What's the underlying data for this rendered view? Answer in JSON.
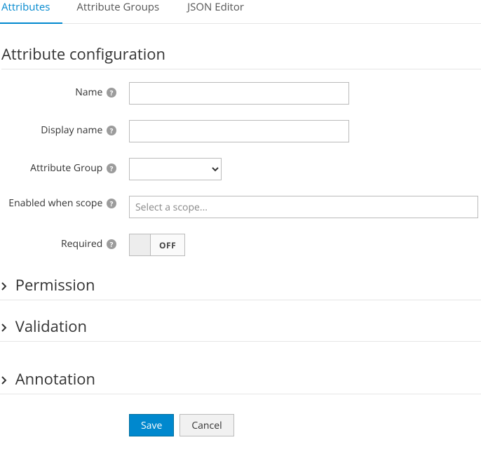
{
  "tabs": {
    "attributes": "Attributes",
    "groups": "Attribute Groups",
    "json": "JSON Editor"
  },
  "section_title": "Attribute configuration",
  "form": {
    "name_label": "Name",
    "name_value": "",
    "display_name_label": "Display name",
    "display_name_value": "",
    "attribute_group_label": "Attribute Group",
    "attribute_group_value": "",
    "enabled_when_scope_label": "Enabled when scope",
    "enabled_when_scope_placeholder": "Select a scope...",
    "enabled_when_scope_value": "",
    "required_label": "Required",
    "required_toggle": "OFF"
  },
  "sections": {
    "permission": "Permission",
    "validation": "Validation",
    "annotation": "Annotation"
  },
  "buttons": {
    "save": "Save",
    "cancel": "Cancel"
  }
}
